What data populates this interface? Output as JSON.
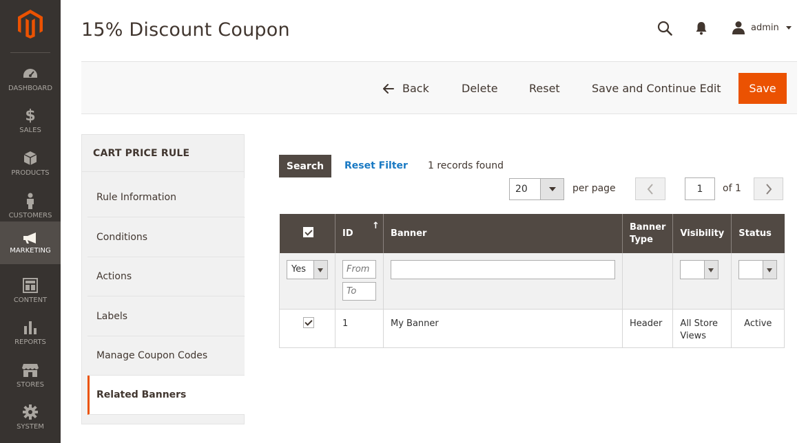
{
  "sidebar": {
    "items": [
      {
        "label": "DASHBOARD",
        "icon": "dashboard-icon"
      },
      {
        "label": "SALES",
        "icon": "dollar-icon"
      },
      {
        "label": "PRODUCTS",
        "icon": "box-icon"
      },
      {
        "label": "CUSTOMERS",
        "icon": "person-icon"
      },
      {
        "label": "MARKETING",
        "icon": "megaphone-icon",
        "active": true
      },
      {
        "label": "CONTENT",
        "icon": "content-icon"
      },
      {
        "label": "REPORTS",
        "icon": "bar-chart-icon"
      },
      {
        "label": "STORES",
        "icon": "store-icon"
      },
      {
        "label": "SYSTEM",
        "icon": "gear-icon"
      }
    ]
  },
  "header": {
    "title": "15% Discount Coupon",
    "user": "admin"
  },
  "actions": {
    "back": "Back",
    "delete": "Delete",
    "reset": "Reset",
    "save_continue": "Save and Continue Edit",
    "save": "Save"
  },
  "tabs": {
    "title": "CART PRICE RULE",
    "items": [
      "Rule Information",
      "Conditions",
      "Actions",
      "Labels",
      "Manage Coupon Codes",
      "Related Banners"
    ],
    "active": "Related Banners"
  },
  "grid": {
    "search_label": "Search",
    "reset_filter_label": "Reset Filter",
    "records_text": "1 records found",
    "per_page_value": "20",
    "per_page_label": "per page",
    "page_value": "1",
    "page_of": "of 1",
    "columns": {
      "id": "ID",
      "banner": "Banner",
      "banner_type": "Banner Type",
      "visibility": "Visibility",
      "status": "Status"
    },
    "filters": {
      "select_value": "Yes",
      "from_placeholder": "From",
      "to_placeholder": "To"
    },
    "rows": [
      {
        "id": "1",
        "banner": "My Banner",
        "banner_type": "Header",
        "visibility": "All Store Views",
        "status": "Active",
        "checked": true
      }
    ]
  },
  "colors": {
    "accent": "#eb5202",
    "sidebar_bg": "#373330",
    "grid_header_bg": "#514943",
    "link": "#1979c3"
  }
}
